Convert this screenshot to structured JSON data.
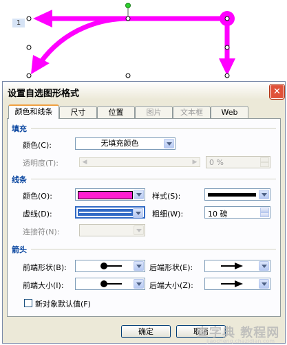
{
  "canvas": {
    "page_number": "1",
    "arrow_color": "#ff00ff"
  },
  "dialog": {
    "title": "设置自选图形格式",
    "tabs": [
      {
        "label": "颜色和线条",
        "active": true,
        "disabled": false
      },
      {
        "label": "尺寸",
        "active": false,
        "disabled": false
      },
      {
        "label": "位置",
        "active": false,
        "disabled": false
      },
      {
        "label": "图片",
        "active": false,
        "disabled": true
      },
      {
        "label": "文本框",
        "active": false,
        "disabled": true
      },
      {
        "label": "Web",
        "active": false,
        "disabled": false
      }
    ],
    "fill": {
      "heading": "填充",
      "color_label": "颜色(C):",
      "color_value": "无填充颜色",
      "transparency_label": "透明度(T):",
      "transparency_value": "0 %"
    },
    "line": {
      "heading": "线条",
      "color_label": "颜色(O):",
      "color_value": "#ff1fd0",
      "style_label": "样式(S):",
      "dashed_label": "虚线(D):",
      "weight_label": "粗细(W):",
      "weight_value": "10 磅",
      "connector_label": "连接符(N):"
    },
    "arrows": {
      "heading": "箭头",
      "begin_style_label": "前端形状(B):",
      "end_style_label": "后端形状(E):",
      "begin_size_label": "前端大小(I):",
      "end_size_label": "后端大小(Z):"
    },
    "default_checkbox_label": "新对象默认值(F)",
    "ok_label": "确定",
    "cancel_label": "取消"
  },
  "watermark": {
    "text": "查字典 教程网",
    "url": "jiaocheng.chazidian.com"
  },
  "colors": {
    "accent": "#0a46a0",
    "title_close": "#e0523a"
  }
}
